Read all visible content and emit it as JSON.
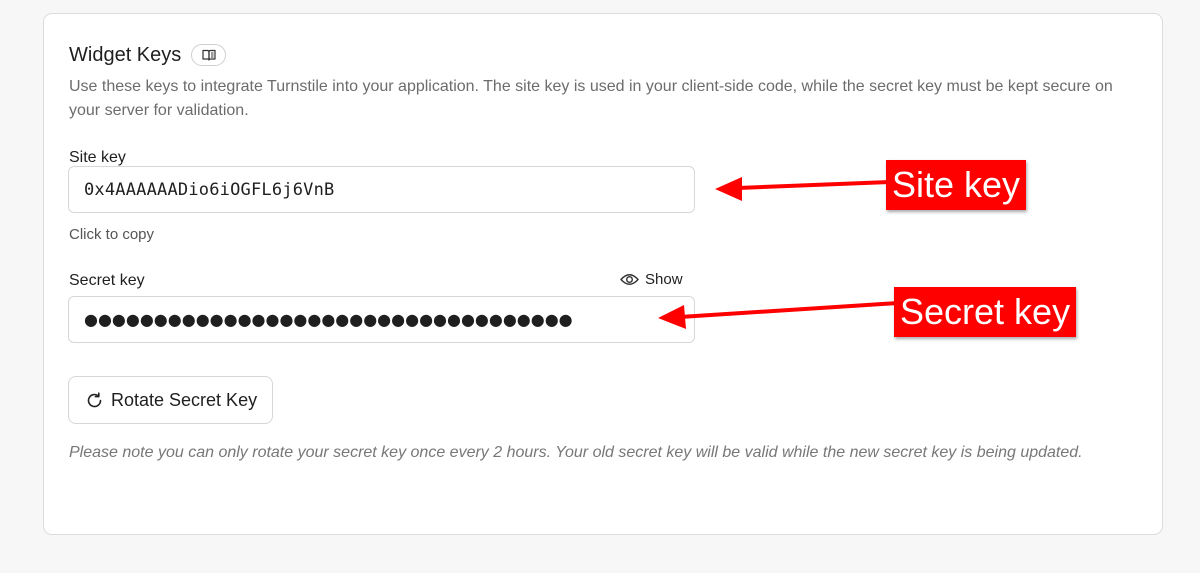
{
  "panel": {
    "title": "Widget Keys",
    "docs_icon": "book-icon",
    "description": "Use these keys to integrate Turnstile into your application. The site key is used in your client-side code, while the secret key must be kept secure on your server for validation."
  },
  "site_key": {
    "label": "Site key",
    "value": "0x4AAAAAADio6iOGFL6j6VnB",
    "hint": "Click to copy"
  },
  "secret_key": {
    "label": "Secret key",
    "masked_value": "●●●●●●●●●●●●●●●●●●●●●●●●●●●●●●●●●●●",
    "show_label": "Show",
    "show_icon": "eye-icon"
  },
  "rotate": {
    "label": "Rotate Secret Key",
    "icon": "refresh-icon",
    "note": "Please note you can only rotate your secret key once every 2 hours. Your old secret key will be valid while the new secret key is being updated."
  },
  "annotations": {
    "site_key_callout": "Site key",
    "secret_key_callout": "Secret key",
    "color": "#ff0000"
  }
}
